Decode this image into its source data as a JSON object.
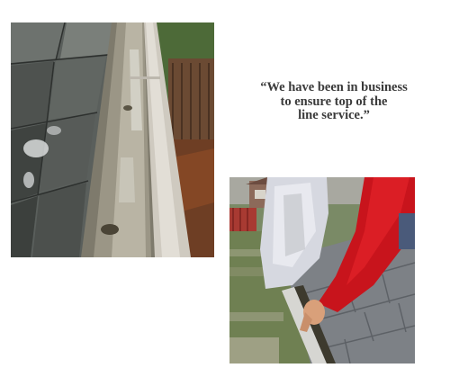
{
  "quote": {
    "line1": "“We have been in business",
    "line2": "to ensure top of the",
    "line3": "line service.”"
  },
  "photos": {
    "gutter": {
      "subject": "rain gutter along shingled roof edge"
    },
    "worker": {
      "subject": "worker in red sleeve cleaning a gutter"
    }
  },
  "colors": {
    "background": "#ffffff",
    "quote_text": "#3a3a3a",
    "shirt_red": "#c8141c",
    "shingle_gray": "#5a5f5c"
  }
}
